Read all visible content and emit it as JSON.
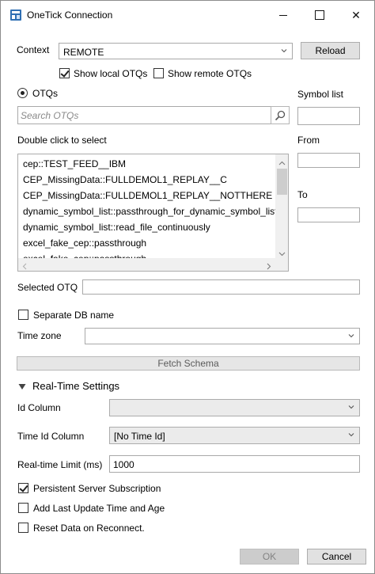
{
  "window": {
    "title": "OneTick Connection",
    "minimize_icon": "minimize-icon",
    "maximize_icon": "maximize-icon",
    "close_glyph": "✕"
  },
  "context": {
    "label": "Context",
    "value": "REMOTE",
    "reload_label": "Reload"
  },
  "filters": {
    "show_local_label": "Show local OTQs",
    "show_local_checked": true,
    "show_remote_label": "Show remote OTQs",
    "show_remote_checked": false
  },
  "otqs": {
    "radio_label": "OTQs",
    "search_placeholder": "Search OTQs",
    "hint": "Double click to select",
    "items": [
      "cep::TEST_FEED__IBM",
      "CEP_MissingData::FULLDEMOL1_REPLAY__C",
      "CEP_MissingData::FULLDEMOL1_REPLAY__NOTTHERE",
      "dynamic_symbol_list::passthrough_for_dynamic_symbol_list",
      "dynamic_symbol_list::read_file_continuously",
      "excel_fake_cep::passthrough",
      "excel_fake_cep::passthrough"
    ]
  },
  "right_panel": {
    "symbol_list_label": "Symbol list",
    "from_label": "From",
    "to_label": "To"
  },
  "selected_otq": {
    "label": "Selected OTQ",
    "value": ""
  },
  "separate_db": {
    "label": "Separate DB name",
    "checked": false
  },
  "time_zone": {
    "label": "Time zone",
    "value": ""
  },
  "fetch_schema_label": "Fetch Schema",
  "realtime": {
    "header": "Real-Time Settings",
    "id_column_label": "Id Column",
    "id_column_value": "",
    "time_id_column_label": "Time Id Column",
    "time_id_column_value": "[No Time Id]",
    "limit_label": "Real-time Limit (ms)",
    "limit_value": "1000",
    "persistent_label": "Persistent Server Subscription",
    "persistent_checked": true,
    "add_last_update_label": "Add Last Update Time and Age",
    "add_last_update_checked": false,
    "reset_label": "Reset Data on Reconnect.",
    "reset_checked": false
  },
  "footer": {
    "ok_label": "OK",
    "cancel_label": "Cancel"
  }
}
